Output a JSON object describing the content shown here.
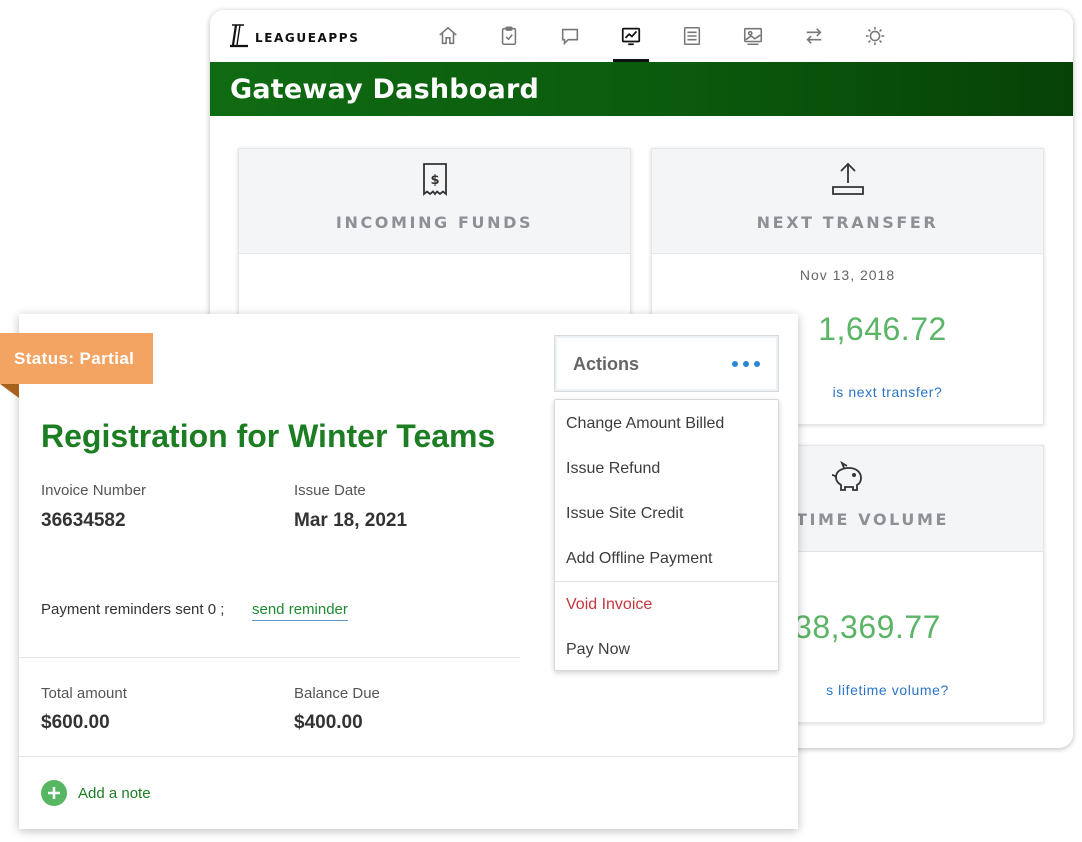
{
  "app": {
    "logo_text": "LEAGUEAPPS",
    "page_title": "Gateway Dashboard"
  },
  "nav": {
    "icons": [
      "home-icon",
      "clipboard-check-icon",
      "chat-icon",
      "chart-icon",
      "document-icon",
      "image-icon",
      "transfer-icon",
      "settings-icon"
    ],
    "active": "chart-icon"
  },
  "cards": {
    "incoming": {
      "label": "INCOMING FUNDS",
      "icon": "receipt-dollar-icon"
    },
    "next_transfer": {
      "label": "NEXT TRANSFER",
      "icon": "upload-icon",
      "date": "Nov 13, 2018",
      "amount": "1,646.72",
      "link": "is next transfer?"
    },
    "lifetime": {
      "label": "TIME VOLUME",
      "icon": "piggy-bank-icon",
      "amount": "38,369.77",
      "link": "s lifetime volume?"
    }
  },
  "invoice": {
    "status": "Status: Partial",
    "title": "Registration for Winter Teams",
    "invoice_number_label": "Invoice Number",
    "invoice_number": "36634582",
    "issue_date_label": "Issue Date",
    "issue_date": "Mar 18, 2021",
    "reminders_text": "Payment reminders sent 0 ;",
    "send_reminder": "send reminder",
    "total_label": "Total amount",
    "total": "$600.00",
    "balance_label": "Balance Due",
    "balance": "$400.00",
    "add_note": "Add a note"
  },
  "actions": {
    "label": "Actions",
    "items": [
      "Change Amount Billed",
      "Issue Refund",
      "Issue Site Credit",
      "Add Offline Payment",
      "Void Invoice",
      "Pay Now"
    ]
  },
  "colors": {
    "brand_green": "#1c7d23",
    "header_green": "#0b5a0d",
    "status_orange": "#f4a462",
    "amount_green": "#5cb466",
    "link_blue": "#2a74c9",
    "danger_red": "#c9343c"
  }
}
